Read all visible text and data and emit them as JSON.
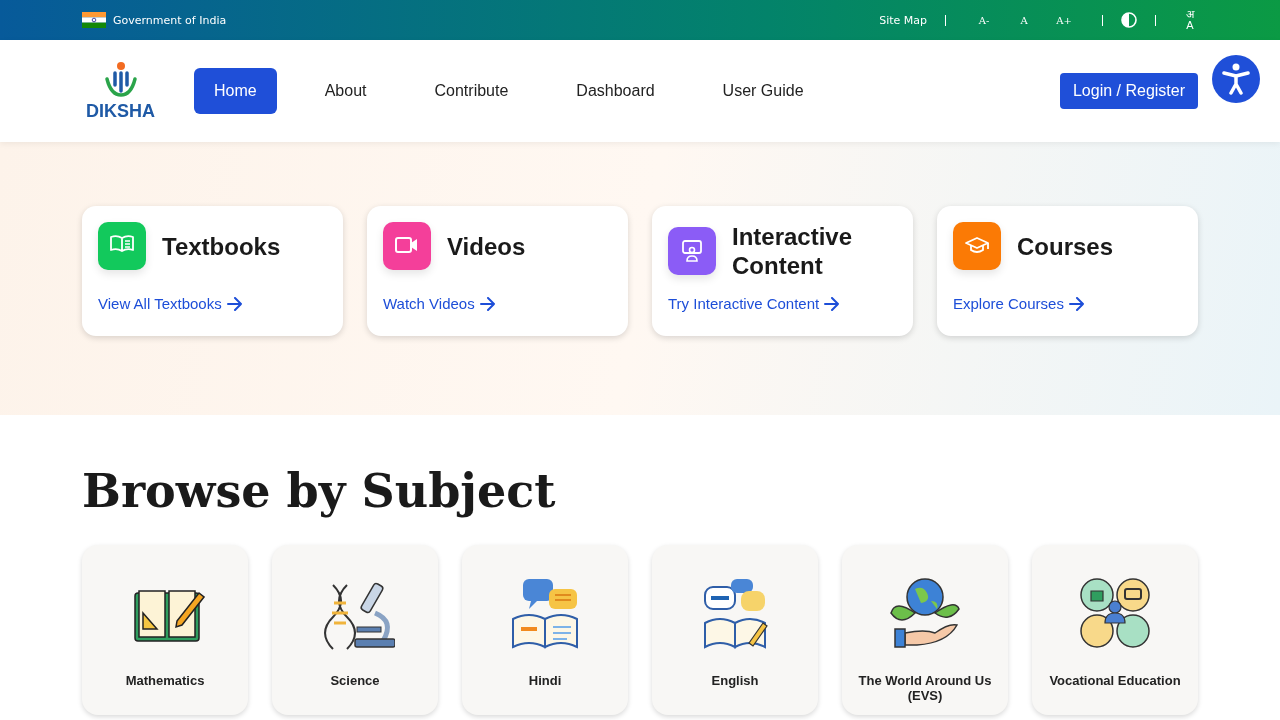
{
  "top_bar": {
    "government": "Government of India",
    "site_map": "Site Map",
    "font_controls": [
      "A-",
      "A",
      "A+"
    ],
    "language_toggle": {
      "top": "अ",
      "bottom": "A"
    }
  },
  "header": {
    "logo": "DIKSHA",
    "nav": [
      {
        "label": "Home",
        "selected": true
      },
      {
        "label": "About",
        "selected": false
      },
      {
        "label": "Contribute",
        "selected": false
      },
      {
        "label": "Dashboard",
        "selected": false
      },
      {
        "label": "User Guide",
        "selected": false
      }
    ],
    "login_button": "Login / Register"
  },
  "feature_cards": [
    {
      "kind": "book",
      "title": "Textbooks",
      "link": "View All Textbooks",
      "color": "#12c95c"
    },
    {
      "kind": "video",
      "title": "Videos",
      "link": "Watch Videos",
      "color": "#f43f9a"
    },
    {
      "kind": "interactive",
      "title": "Interactive Content",
      "link": "Try Interactive Content",
      "color": "#8b5cf6"
    },
    {
      "kind": "course",
      "title": "Courses",
      "link": "Explore Courses",
      "color": "#fb7a05"
    }
  ],
  "browse": {
    "heading": "Browse by Subject",
    "subjects": [
      {
        "kind": "math",
        "name": "Mathematics"
      },
      {
        "kind": "science",
        "name": "Science"
      },
      {
        "kind": "hindi",
        "name": "Hindi"
      },
      {
        "kind": "english",
        "name": "English"
      },
      {
        "kind": "evs",
        "name": "The World Around Us (EVS)"
      },
      {
        "kind": "vocational",
        "name": "Vocational Education"
      }
    ]
  }
}
